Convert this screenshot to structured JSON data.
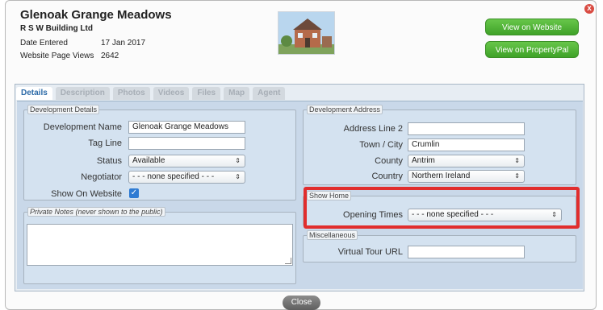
{
  "header": {
    "title": "Glenoak Grange Meadows",
    "builder": "R S W Building Ltd",
    "date_entered_label": "Date Entered",
    "date_entered_value": "17 Jan 2017",
    "page_views_label": "Website Page Views",
    "page_views_value": "2642"
  },
  "buttons": {
    "view_website": "View on Website",
    "view_propertypal": "View on PropertyPal",
    "close": "Close",
    "close_x": "x"
  },
  "tabs": [
    {
      "label": "Details",
      "active": true
    },
    {
      "label": "Description"
    },
    {
      "label": "Photos"
    },
    {
      "label": "Videos"
    },
    {
      "label": "Files"
    },
    {
      "label": "Map"
    },
    {
      "label": "Agent"
    }
  ],
  "development_details": {
    "legend": "Development Details",
    "name_label": "Development Name",
    "name_value": "Glenoak Grange Meadows",
    "tagline_label": "Tag Line",
    "tagline_value": "",
    "status_label": "Status",
    "status_value": "Available",
    "negotiator_label": "Negotiator",
    "negotiator_value": "- - - none specified - - -",
    "show_on_website_label": "Show On Website",
    "show_on_website_checked": true
  },
  "private_notes": {
    "legend": "Private Notes (never shown to the public)",
    "value": ""
  },
  "development_address": {
    "legend": "Development Address",
    "address_line2_label": "Address Line 2",
    "address_line2_value": "",
    "town_label": "Town / City",
    "town_value": "Crumlin",
    "county_label": "County",
    "county_value": "Antrim",
    "country_label": "Country",
    "country_value": "Northern Ireland"
  },
  "show_home": {
    "legend": "Show Home",
    "opening_times_label": "Opening Times",
    "opening_times_value": "- - - none specified - - -"
  },
  "miscellaneous": {
    "legend": "Miscellaneous",
    "virtual_tour_label": "Virtual Tour URL",
    "virtual_tour_value": ""
  },
  "colors": {
    "accent_green": "#4fb235",
    "highlight_red": "#e12d2d",
    "active_tab_text": "#2c6aa7",
    "panel_blue": "#c9d8e9"
  },
  "icons": {
    "select_arrows": "⇕",
    "checkmark": "✓"
  }
}
